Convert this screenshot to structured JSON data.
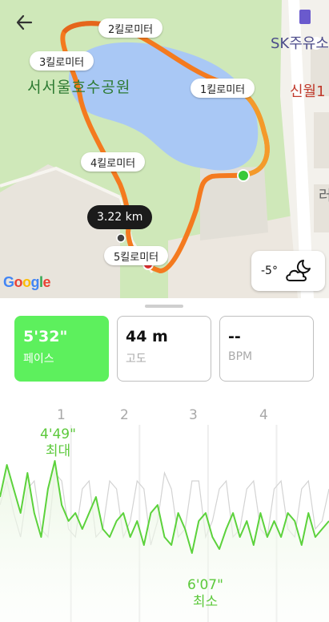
{
  "map": {
    "park_name": "서서울호수공원",
    "poi_gas": "SK주유소",
    "poi_station": "신월1",
    "poi_edge": "러",
    "km_markers": [
      "1킬로미터",
      "2킬로미터",
      "3킬로미터",
      "4킬로미터",
      "5킬로미터"
    ],
    "distance_bubble": "3.22 km",
    "google_logo": "Google",
    "weather_temp": "-5°",
    "weather_icon": "cloud-moon-icon"
  },
  "stats": [
    {
      "value": "5'32\"",
      "label": "페이스",
      "active": true
    },
    {
      "value": "44 m",
      "label": "고도",
      "active": false
    },
    {
      "value": "--",
      "label": "BPM",
      "active": false
    }
  ],
  "chart": {
    "x_ticks": [
      "1",
      "2",
      "3",
      "4"
    ],
    "max_value": "4'49\"",
    "max_label": "최대",
    "min_value": "6'07\"",
    "min_label": "최소",
    "line_color": "#5cd23c",
    "secondary_color": "#d3d3d3"
  },
  "chart_data": {
    "type": "line",
    "x": [
      0.0,
      0.1,
      0.2,
      0.3,
      0.4,
      0.5,
      0.6,
      0.7,
      0.8,
      0.9,
      1.0,
      1.1,
      1.2,
      1.3,
      1.4,
      1.5,
      1.6,
      1.7,
      1.8,
      1.9,
      2.0,
      2.1,
      2.2,
      2.3,
      2.4,
      2.5,
      2.6,
      2.7,
      2.8,
      2.9,
      3.0,
      3.1,
      3.2,
      3.3,
      3.4,
      3.5,
      3.6,
      3.7,
      3.8,
      3.9,
      4.0,
      4.1,
      4.2,
      4.3,
      4.4,
      4.5,
      4.6,
      4.7,
      4.8
    ],
    "series": [
      {
        "values": [
          5.4,
          5.0,
          5.3,
          5.6,
          5.1,
          5.6,
          5.9,
          5.3,
          4.95,
          5.5,
          5.7,
          5.6,
          5.8,
          5.6,
          5.4,
          5.8,
          5.9,
          5.7,
          5.6,
          5.9,
          5.7,
          6.0,
          5.6,
          5.5,
          5.9,
          6.0,
          5.6,
          5.8,
          6.1,
          5.7,
          5.6,
          5.9,
          6.05,
          5.8,
          5.6,
          5.9,
          5.7,
          6.0,
          5.6,
          5.9,
          5.7,
          5.9,
          5.6,
          5.7,
          6.0,
          5.6,
          5.9,
          5.8,
          5.7
        ]
      },
      {
        "values": [
          5.5,
          5.2,
          5.6,
          5.9,
          5.3,
          5.2,
          5.8,
          5.9,
          5.1,
          5.2,
          5.8,
          5.9,
          5.3,
          5.2,
          5.9,
          5.8,
          5.2,
          5.3,
          5.9,
          5.7,
          5.2,
          5.3,
          6.0,
          5.7,
          5.1,
          5.3,
          5.9,
          5.8,
          5.2,
          5.2,
          5.9,
          5.7,
          5.3,
          5.2,
          5.9,
          5.8,
          5.3,
          5.2,
          5.8,
          5.9,
          5.3,
          5.2,
          5.8,
          5.9,
          5.3,
          5.2,
          5.8,
          5.7,
          5.3
        ]
      }
    ],
    "xlim": [
      0,
      4.8
    ],
    "ylim_inverted": true,
    "grid": "vertical at ticks"
  }
}
